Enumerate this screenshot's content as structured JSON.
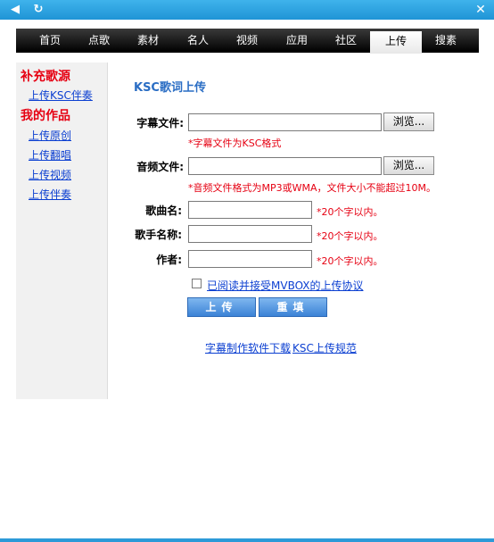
{
  "titlebar": {
    "back_icon": "back-arrow-icon",
    "refresh_icon": "refresh-icon",
    "close_label": "✕",
    "watermark": ""
  },
  "nav": {
    "items": [
      "首页",
      "点歌",
      "素材",
      "名人",
      "视频",
      "应用",
      "社区",
      "上传",
      "搜素"
    ],
    "active": "上传"
  },
  "sidebar": {
    "section1": "补充歌源",
    "link1": "上传KSC伴奏",
    "section2": "我的作品",
    "links": [
      "上传原创",
      "上传翻唱",
      "上传视频",
      "上传伴奏"
    ]
  },
  "form": {
    "title": "KSC歌词上传",
    "subtitle_label": "字幕文件:",
    "subtitle_value": "",
    "subtitle_hint": "*字幕文件为KSC格式",
    "audio_label": "音频文件:",
    "audio_value": "",
    "audio_hint": "*音频文件格式为MP3或WMA，文件大小不能超过10M。",
    "browse_label": "浏览...",
    "song_label": "歌曲名:",
    "song_value": "",
    "song_hint": "*20个字以内。",
    "singer_label": "歌手名称:",
    "singer_value": "",
    "singer_hint": "*20个字以内。",
    "author_label": "作者:",
    "author_value": "",
    "author_hint": "*20个字以内。",
    "agree_text": "已阅读并接受MVBOX的上传协议",
    "upload_button": "上传",
    "reset_button": "重填"
  },
  "footer_links": [
    "字幕制作软件下载",
    "KSC上传规范"
  ]
}
